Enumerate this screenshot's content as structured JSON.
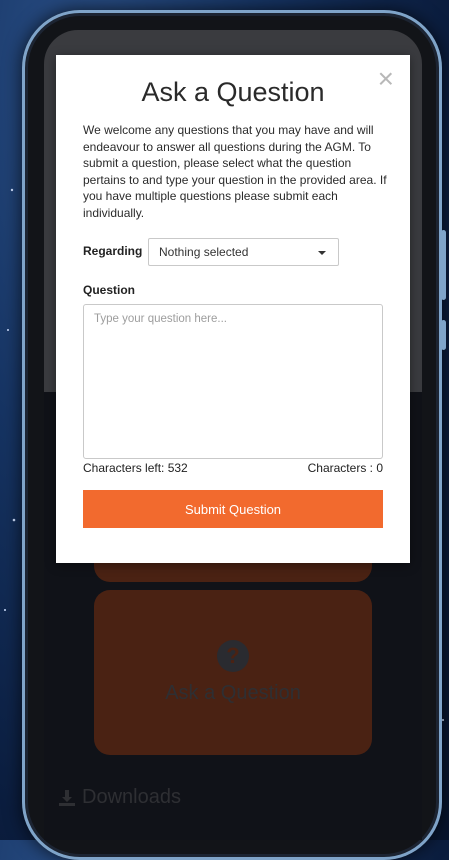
{
  "modal": {
    "title": "Ask a Question",
    "close_symbol": "×",
    "intro": "We welcome any questions that you may have and will endeavour to answer all questions during the AGM. To submit a question, please select what the question pertains to and type your question in the provided area. If you have multiple questions please submit each individually.",
    "regarding_label": "Regarding",
    "regarding_selected": "Nothing selected",
    "question_label": "Question",
    "question_placeholder": "Type your question here...",
    "question_value": "",
    "characters_left": "Characters left: 532",
    "characters_count": "Characters : 0",
    "submit_label": "Submit Question"
  },
  "background": {
    "ask_card_label": "Ask a Question",
    "ask_card_icon": "question-circle-icon",
    "downloads_label": "Downloads",
    "downloads_icon": "download-icon"
  },
  "colors": {
    "accent": "#f26a2e",
    "card_dim": "#4a2213",
    "screen_dark": "#101218"
  }
}
